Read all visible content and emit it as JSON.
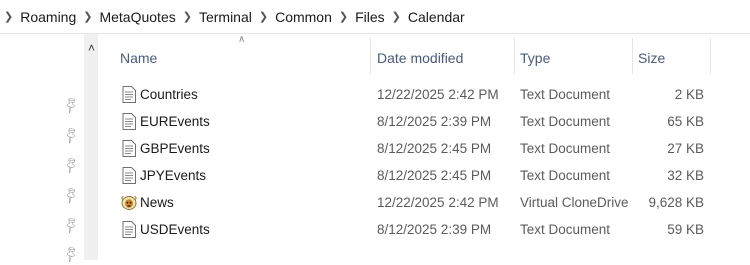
{
  "breadcrumb": [
    "Roaming",
    "MetaQuotes",
    "Terminal",
    "Common",
    "Files",
    "Calendar"
  ],
  "columns": {
    "name": "Name",
    "date": "Date modified",
    "type": "Type",
    "size": "Size"
  },
  "files": [
    {
      "name": "Countries",
      "date": "12/22/2025 2:42 PM",
      "type": "Text Document",
      "size": "2 KB",
      "icon": "text-document-icon"
    },
    {
      "name": "EUREvents",
      "date": "8/12/2025 2:39 PM",
      "type": "Text Document",
      "size": "65 KB",
      "icon": "text-document-icon"
    },
    {
      "name": "GBPEvents",
      "date": "8/12/2025 2:45 PM",
      "type": "Text Document",
      "size": "27 KB",
      "icon": "text-document-icon"
    },
    {
      "name": "JPYEvents",
      "date": "8/12/2025 2:45 PM",
      "type": "Text Document",
      "size": "32 KB",
      "icon": "text-document-icon"
    },
    {
      "name": "News",
      "date": "12/22/2025 2:42 PM",
      "type": "Virtual CloneDrive",
      "size": "9,628 KB",
      "icon": "clonedrive-sheep-icon"
    },
    {
      "name": "USDEvents",
      "date": "8/12/2025 2:39 PM",
      "type": "Text Document",
      "size": "59 KB",
      "icon": "text-document-icon"
    }
  ]
}
